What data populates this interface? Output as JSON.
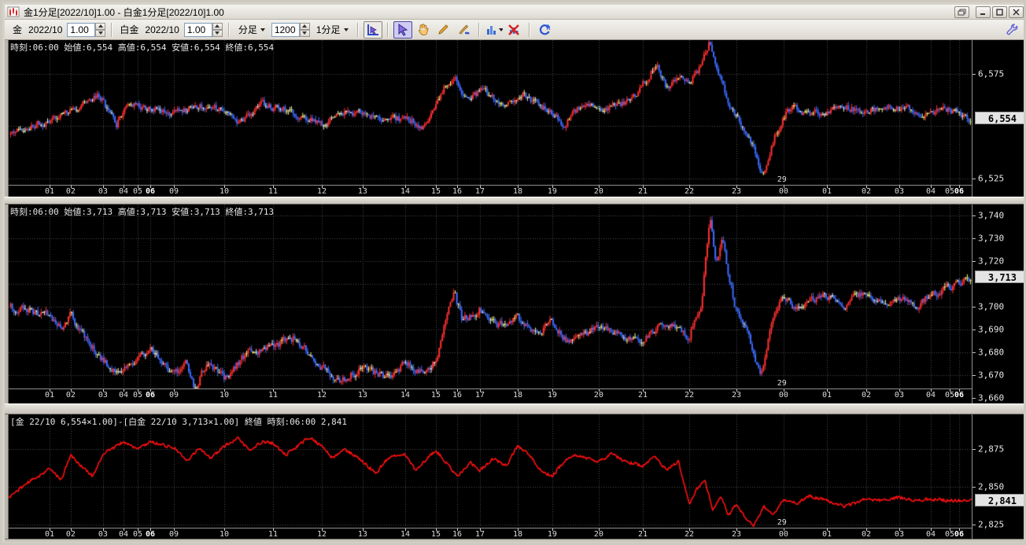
{
  "window": {
    "title": "金1分足[2022/10]1.00 - 白金1分足[2022/10]1.00",
    "icons": {
      "app": "candlestick-chart",
      "controls": [
        "popout-window",
        "minimize",
        "maximize",
        "close"
      ]
    }
  },
  "toolbar": {
    "gold_label": "金",
    "gold_month": "2022/10",
    "gold_ratio": "1.00",
    "platinum_label": "白金",
    "platinum_month": "2022/10",
    "platinum_ratio": "1.00",
    "bar_type": "分足",
    "bar_count": "1200",
    "bar_interval": "1分足",
    "tool_icons": [
      "chart-cursor",
      "select-arrow",
      "hand-pan",
      "pencil-draw",
      "pen-annotate",
      "bar-chart-menu",
      "delete-indicator",
      "refresh"
    ],
    "right_icon": "wrench-settings"
  },
  "colors": {
    "up": "#ff3030",
    "down": "#3d6bff",
    "doji1": "#ffff80",
    "doji2": "#f2f2f2",
    "line": "#ff1010",
    "grid": "#4e4e4e",
    "panel_bg": "#000000",
    "badge_bg": "#e4e4e4"
  },
  "chart_data": {
    "x_ticks": [
      {
        "label": "01",
        "frac": 0.0425
      },
      {
        "label": "02",
        "frac": 0.0645
      },
      {
        "label": "03",
        "frac": 0.098
      },
      {
        "label": "04",
        "frac": 0.1193
      },
      {
        "label": "05",
        "frac": 0.134
      },
      {
        "label": "06",
        "frac": 0.1471,
        "bold": true
      },
      {
        "label": "09",
        "frac": 0.1716
      },
      {
        "label": "10",
        "frac": 0.2239
      },
      {
        "label": "11",
        "frac": 0.2745
      },
      {
        "label": "12",
        "frac": 0.3252
      },
      {
        "label": "13",
        "frac": 0.3676
      },
      {
        "label": "14",
        "frac": 0.4118
      },
      {
        "label": "15",
        "frac": 0.4436
      },
      {
        "label": "16",
        "frac": 0.4657
      },
      {
        "label": "17",
        "frac": 0.4894
      },
      {
        "label": "18",
        "frac": 0.5286
      },
      {
        "label": "19",
        "frac": 0.5645
      },
      {
        "label": "20",
        "frac": 0.6127
      },
      {
        "label": "21",
        "frac": 0.6585
      },
      {
        "label": "22",
        "frac": 0.7067
      },
      {
        "label": "23",
        "frac": 0.7557
      },
      {
        "label": "00",
        "frac": 0.8047
      },
      {
        "label": "01",
        "frac": 0.8497
      },
      {
        "label": "02",
        "frac": 0.8905
      },
      {
        "label": "03",
        "frac": 0.9248
      },
      {
        "label": "04",
        "frac": 0.9575
      },
      {
        "label": "05",
        "frac": 0.9771
      },
      {
        "label": "06",
        "frac": 0.9869,
        "bold": true
      }
    ],
    "panels": [
      {
        "name": "gold-1min",
        "type": "candlestick",
        "header": "時刻:06:00 始値:6,554 高値:6,554 安値:6,554 終値:6,554",
        "ylim": [
          6522,
          6591
        ],
        "y_ticks": [
          {
            "label": "6,575",
            "price": 6575
          },
          {
            "label": "6,525",
            "price": 6525
          }
        ],
        "grid_prices": [
          6575,
          6550,
          6525
        ],
        "badge": {
          "label": "6,554",
          "price": 6554
        },
        "date_label": {
          "text": "29",
          "frac": 0.798
        },
        "anchors": [
          [
            0,
            6546
          ],
          [
            0.018,
            6550
          ],
          [
            0.0425,
            6552
          ],
          [
            0.0645,
            6557
          ],
          [
            0.0833,
            6562
          ],
          [
            0.0931,
            6565
          ],
          [
            0.105,
            6556
          ],
          [
            0.1119,
            6551
          ],
          [
            0.1242,
            6561
          ],
          [
            0.1471,
            6558
          ],
          [
            0.169,
            6556
          ],
          [
            0.1977,
            6560
          ],
          [
            0.2239,
            6558
          ],
          [
            0.2386,
            6552
          ],
          [
            0.2631,
            6560
          ],
          [
            0.2958,
            6557
          ],
          [
            0.3252,
            6550
          ],
          [
            0.3448,
            6557
          ],
          [
            0.3775,
            6555
          ],
          [
            0.4183,
            6553
          ],
          [
            0.4306,
            6549
          ],
          [
            0.4436,
            6558
          ],
          [
            0.4551,
            6570
          ],
          [
            0.4632,
            6574
          ],
          [
            0.4755,
            6562
          ],
          [
            0.4918,
            6567
          ],
          [
            0.5163,
            6559
          ],
          [
            0.5327,
            6565
          ],
          [
            0.549,
            6561
          ],
          [
            0.5645,
            6556
          ],
          [
            0.5776,
            6551
          ],
          [
            0.598,
            6561
          ],
          [
            0.6225,
            6558
          ],
          [
            0.647,
            6563
          ],
          [
            0.6634,
            6572
          ],
          [
            0.6732,
            6580
          ],
          [
            0.6838,
            6567
          ],
          [
            0.6944,
            6573
          ],
          [
            0.7067,
            6570
          ],
          [
            0.719,
            6578
          ],
          [
            0.7288,
            6590
          ],
          [
            0.7353,
            6580
          ],
          [
            0.741,
            6572
          ],
          [
            0.7492,
            6560
          ],
          [
            0.7557,
            6556
          ],
          [
            0.7655,
            6548
          ],
          [
            0.7761,
            6537
          ],
          [
            0.7843,
            6527
          ],
          [
            0.7925,
            6540
          ],
          [
            0.8047,
            6554
          ],
          [
            0.8145,
            6560
          ],
          [
            0.8268,
            6556
          ],
          [
            0.8497,
            6557
          ],
          [
            0.8718,
            6559
          ],
          [
            0.8905,
            6557
          ],
          [
            0.9126,
            6559
          ],
          [
            0.933,
            6558
          ],
          [
            0.9575,
            6556
          ],
          [
            0.9779,
            6558
          ],
          [
            0.9935,
            6555
          ],
          [
            1,
            6554
          ]
        ]
      },
      {
        "name": "platinum-1min",
        "type": "candlestick",
        "header": "時刻:06:00 始値:3,713 高値:3,713 安値:3,713 終値:3,713",
        "ylim": [
          3664,
          3745
        ],
        "y_ticks": [
          {
            "label": "3,740",
            "price": 3740
          },
          {
            "label": "3,730",
            "price": 3730
          },
          {
            "label": "3,720",
            "price": 3720
          },
          {
            "label": "3,700",
            "price": 3700
          },
          {
            "label": "3,690",
            "price": 3690
          },
          {
            "label": "3,680",
            "price": 3680
          },
          {
            "label": "3,670",
            "price": 3670
          },
          {
            "label": "3,660",
            "price": 3660
          }
        ],
        "grid_prices": [
          3740,
          3730,
          3720,
          3710,
          3700,
          3690,
          3680,
          3670
        ],
        "badge": {
          "label": "3,713",
          "price": 3713
        },
        "date_label": {
          "text": "29",
          "frac": 0.798
        },
        "anchors": [
          [
            0,
            3700
          ],
          [
            0.0425,
            3696
          ],
          [
            0.055,
            3690
          ],
          [
            0.0645,
            3697
          ],
          [
            0.075,
            3688
          ],
          [
            0.098,
            3676
          ],
          [
            0.112,
            3671
          ],
          [
            0.134,
            3676
          ],
          [
            0.1471,
            3681
          ],
          [
            0.1716,
            3670
          ],
          [
            0.185,
            3676
          ],
          [
            0.1935,
            3663
          ],
          [
            0.206,
            3676
          ],
          [
            0.2239,
            3669
          ],
          [
            0.247,
            3679
          ],
          [
            0.2745,
            3683
          ],
          [
            0.296,
            3686
          ],
          [
            0.3252,
            3674
          ],
          [
            0.345,
            3667
          ],
          [
            0.3676,
            3673
          ],
          [
            0.394,
            3669
          ],
          [
            0.4118,
            3675
          ],
          [
            0.4306,
            3671
          ],
          [
            0.4436,
            3676
          ],
          [
            0.451,
            3688
          ],
          [
            0.459,
            3703
          ],
          [
            0.4632,
            3706
          ],
          [
            0.4714,
            3694
          ],
          [
            0.4894,
            3699
          ],
          [
            0.508,
            3691
          ],
          [
            0.5286,
            3696
          ],
          [
            0.549,
            3687
          ],
          [
            0.5645,
            3694
          ],
          [
            0.5817,
            3684
          ],
          [
            0.6127,
            3691
          ],
          [
            0.638,
            3687
          ],
          [
            0.6585,
            3684
          ],
          [
            0.68,
            3693
          ],
          [
            0.7067,
            3687
          ],
          [
            0.7206,
            3701
          ],
          [
            0.7288,
            3741
          ],
          [
            0.7353,
            3719
          ],
          [
            0.7418,
            3729
          ],
          [
            0.7557,
            3699
          ],
          [
            0.7697,
            3687
          ],
          [
            0.7819,
            3669
          ],
          [
            0.7942,
            3696
          ],
          [
            0.8047,
            3706
          ],
          [
            0.8186,
            3699
          ],
          [
            0.8497,
            3705
          ],
          [
            0.868,
            3701
          ],
          [
            0.8905,
            3706
          ],
          [
            0.9126,
            3702
          ],
          [
            0.9248,
            3704
          ],
          [
            0.9453,
            3701
          ],
          [
            0.9575,
            3705
          ],
          [
            0.978,
            3708
          ],
          [
            1,
            3713
          ]
        ]
      },
      {
        "name": "gold-platinum-spread",
        "type": "line",
        "header": "[金 22/10 6,554×1.00]-[白金 22/10 3,713×1.00] 終値 時刻:06:00 2,841",
        "ylim": [
          2823,
          2898
        ],
        "y_ticks": [
          {
            "label": "2,875",
            "price": 2875
          },
          {
            "label": "2,850",
            "price": 2850
          },
          {
            "label": "2,825",
            "price": 2825
          }
        ],
        "grid_prices": [
          2875,
          2850,
          2825
        ],
        "badge": {
          "label": "2,841",
          "price": 2841
        },
        "date_label": {
          "text": "29",
          "frac": 0.798
        },
        "anchors": [
          [
            0,
            2843
          ],
          [
            0.018,
            2852
          ],
          [
            0.0425,
            2862
          ],
          [
            0.0547,
            2855
          ],
          [
            0.0645,
            2871
          ],
          [
            0.0752,
            2864
          ],
          [
            0.0874,
            2857
          ],
          [
            0.098,
            2872
          ],
          [
            0.1119,
            2877
          ],
          [
            0.1193,
            2880
          ],
          [
            0.134,
            2875
          ],
          [
            0.1471,
            2880
          ],
          [
            0.1716,
            2876
          ],
          [
            0.1854,
            2867
          ],
          [
            0.1977,
            2876
          ],
          [
            0.21,
            2869
          ],
          [
            0.2239,
            2877
          ],
          [
            0.2386,
            2882
          ],
          [
            0.2508,
            2874
          ],
          [
            0.2631,
            2880
          ],
          [
            0.2745,
            2879
          ],
          [
            0.2876,
            2871
          ],
          [
            0.2999,
            2877
          ],
          [
            0.3121,
            2883
          ],
          [
            0.3252,
            2877
          ],
          [
            0.3366,
            2869
          ],
          [
            0.3489,
            2875
          ],
          [
            0.3676,
            2867
          ],
          [
            0.3816,
            2859
          ],
          [
            0.3938,
            2869
          ],
          [
            0.4118,
            2872
          ],
          [
            0.4224,
            2861
          ],
          [
            0.4347,
            2869
          ],
          [
            0.4436,
            2874
          ],
          [
            0.4534,
            2867
          ],
          [
            0.4657,
            2857
          ],
          [
            0.4796,
            2866
          ],
          [
            0.4894,
            2861
          ],
          [
            0.5041,
            2869
          ],
          [
            0.5163,
            2864
          ],
          [
            0.5286,
            2877
          ],
          [
            0.5409,
            2871
          ],
          [
            0.5531,
            2861
          ],
          [
            0.5645,
            2857
          ],
          [
            0.5768,
            2867
          ],
          [
            0.589,
            2871
          ],
          [
            0.6127,
            2867
          ],
          [
            0.6266,
            2872
          ],
          [
            0.6389,
            2867
          ],
          [
            0.6585,
            2864
          ],
          [
            0.6708,
            2871
          ],
          [
            0.683,
            2861
          ],
          [
            0.6953,
            2867
          ],
          [
            0.7067,
            2839
          ],
          [
            0.7149,
            2849
          ],
          [
            0.7231,
            2854
          ],
          [
            0.7312,
            2834
          ],
          [
            0.7394,
            2844
          ],
          [
            0.7476,
            2831
          ],
          [
            0.7557,
            2839
          ],
          [
            0.7655,
            2829
          ],
          [
            0.7737,
            2824
          ],
          [
            0.7843,
            2837
          ],
          [
            0.7942,
            2831
          ],
          [
            0.8047,
            2842
          ],
          [
            0.8186,
            2839
          ],
          [
            0.8309,
            2844
          ],
          [
            0.8497,
            2841
          ],
          [
            0.868,
            2837
          ],
          [
            0.8905,
            2842
          ],
          [
            0.9085,
            2841
          ],
          [
            0.9248,
            2843
          ],
          [
            0.9411,
            2841
          ],
          [
            0.9575,
            2842
          ],
          [
            0.9738,
            2841
          ],
          [
            1,
            2841
          ]
        ]
      }
    ]
  }
}
